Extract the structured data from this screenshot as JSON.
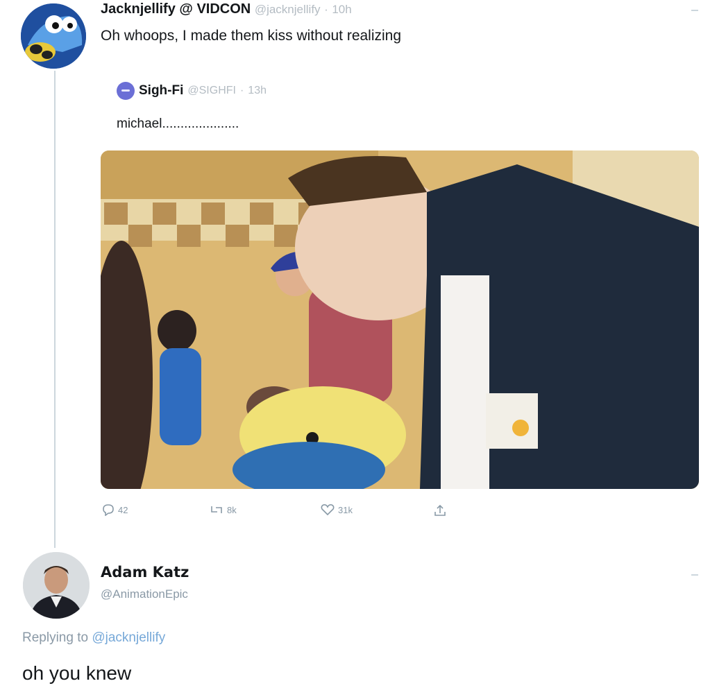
{
  "tweet": {
    "author_name": "Jacknjellify @ VIDCON",
    "author_handle": "@jacknjellify",
    "time": "10h",
    "text": "Oh whoops, I made them kiss without realizing"
  },
  "quoted": {
    "author_name": "Sigh-Fi",
    "author_handle": "@SIGHFI",
    "time": "13h",
    "text": "michael....................."
  },
  "actions": {
    "reply_count": "42",
    "retweet_count": "8k",
    "like_count": "31k"
  },
  "icons": {
    "reply": "reply-icon",
    "retweet": "retweet-icon",
    "like": "heart-icon",
    "share": "share-icon"
  },
  "reply": {
    "author_name": "Adam Katz",
    "author_handle": "@AnimationEpic",
    "replying_prefix": "Replying to",
    "replying_to": "@jacknjellify",
    "text": "oh you knew"
  },
  "colors": {
    "link": "#76a8d8",
    "muted": "#8a99a6",
    "divider": "#ccd6dd"
  }
}
